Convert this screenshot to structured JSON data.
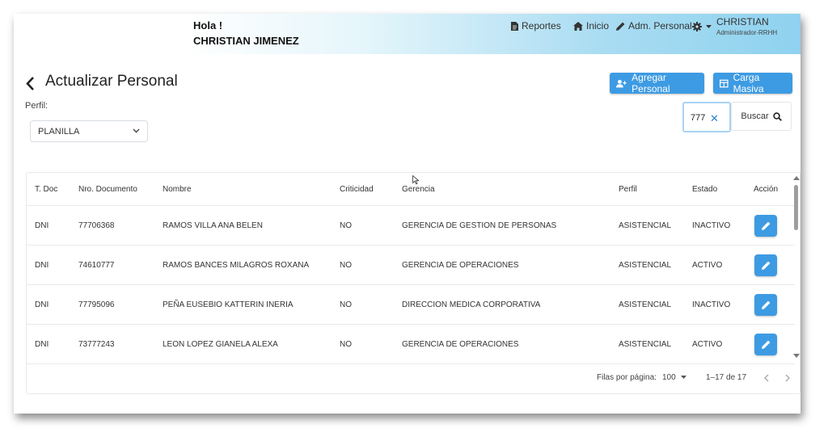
{
  "header": {
    "greeting": "Hola !",
    "user_full_name": "CHRISTIAN JIMENEZ",
    "nav": [
      {
        "label": "Reportes",
        "icon": "document-icon"
      },
      {
        "label": "Inicio",
        "icon": "home-icon"
      },
      {
        "label": "Adm. Personal",
        "icon": "pencil-icon"
      }
    ],
    "settings_icon": "gear-icon",
    "user_name": "CHRISTIAN",
    "user_role": "Administrador-RRHH"
  },
  "page": {
    "title": "Actualizar Personal",
    "perfil_label": "Perfil:",
    "perfil_value": "PLANILLA",
    "add_button": "Agregar Personal",
    "bulk_button": "Carga Masiva",
    "search_value": "777",
    "search_button": "Buscar"
  },
  "table": {
    "headers": [
      "T. Doc",
      "Nro. Documento",
      "Nombre",
      "Criticidad",
      "Gerencia",
      "Perfil",
      "Estado",
      "Acción"
    ],
    "rows": [
      [
        "DNI",
        "77706368",
        "RAMOS VILLA ANA BELEN",
        "NO",
        "GERENCIA DE GESTION DE PERSONAS",
        "ASISTENCIAL",
        "INACTIVO"
      ],
      [
        "DNI",
        "74610777",
        "RAMOS BANCES MILAGROS ROXANA",
        "NO",
        "GERENCIA DE OPERACIONES",
        "ASISTENCIAL",
        "ACTIVO"
      ],
      [
        "DNI",
        "77795096",
        "PEÑA EUSEBIO KATTERIN INERIA",
        "NO",
        "DIRECCION MEDICA CORPORATIVA",
        "ASISTENCIAL",
        "INACTIVO"
      ],
      [
        "DNI",
        "73777243",
        "LEON LOPEZ GIANELA ALEXA",
        "NO",
        "GERENCIA DE OPERACIONES",
        "ASISTENCIAL",
        "ACTIVO"
      ]
    ]
  },
  "pagination": {
    "rows_label": "Filas por página:",
    "rows_value": "100",
    "range": "1–17 de 17"
  },
  "colors": {
    "accent": "#3d9be3",
    "header_gradient_end": "#8fd2ef"
  }
}
